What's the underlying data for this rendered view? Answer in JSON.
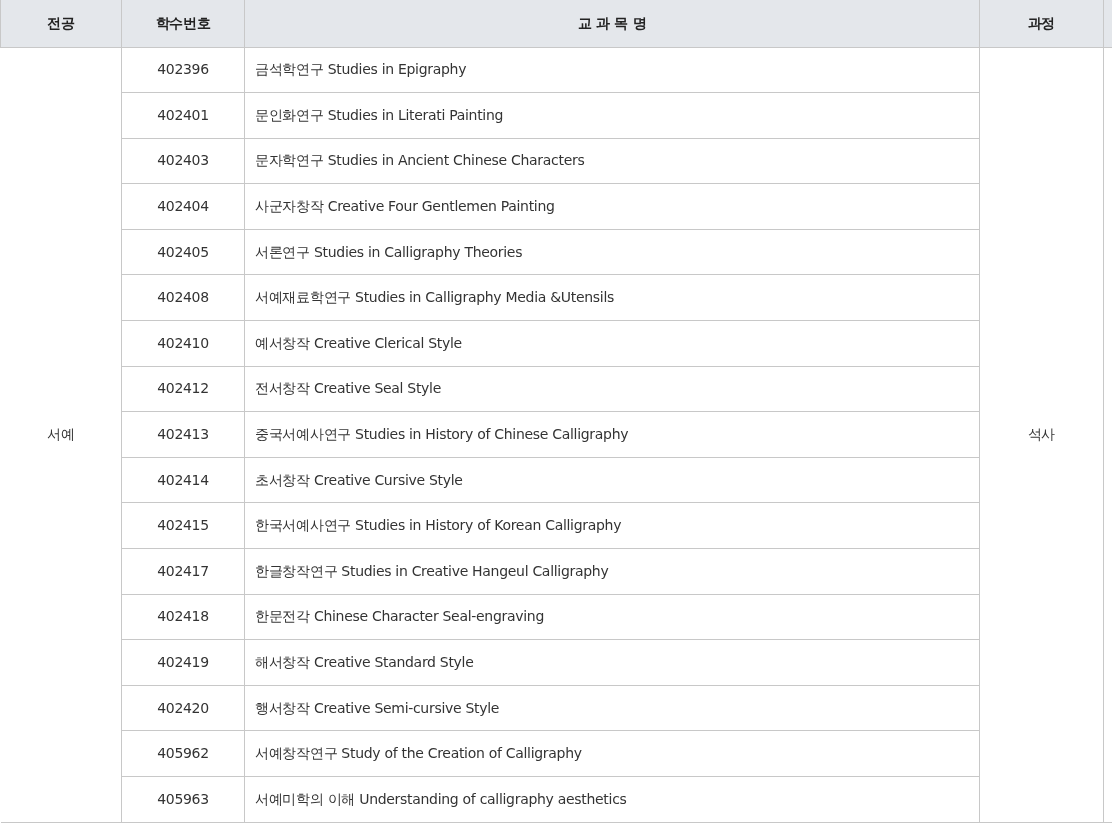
{
  "table": {
    "columns": [
      "전공",
      "학수번호",
      "교 과 목 명",
      "과정"
    ],
    "major": "서예",
    "program": "석사",
    "rows": [
      {
        "code": "402396",
        "name": "금석학연구 Studies in Epigraphy"
      },
      {
        "code": "402401",
        "name": "문인화연구 Studies in Literati Painting"
      },
      {
        "code": "402403",
        "name": "문자학연구 Studies in Ancient Chinese Characters"
      },
      {
        "code": "402404",
        "name": "사군자창작 Creative Four Gentlemen Painting"
      },
      {
        "code": "402405",
        "name": "서론연구 Studies in Calligraphy Theories"
      },
      {
        "code": "402408",
        "name": "서예재료학연구 Studies in Calligraphy Media &Utensils"
      },
      {
        "code": "402410",
        "name": "예서창작 Creative Clerical Style"
      },
      {
        "code": "402412",
        "name": "전서창작 Creative Seal Style"
      },
      {
        "code": "402413",
        "name": "중국서예사연구 Studies in History of Chinese Calligraphy"
      },
      {
        "code": "402414",
        "name": "초서창작 Creative Cursive Style"
      },
      {
        "code": "402415",
        "name": "한국서예사연구 Studies in History of Korean Calligraphy"
      },
      {
        "code": "402417",
        "name": "한글창작연구 Studies in Creative Hangeul Calligraphy"
      },
      {
        "code": "402418",
        "name": "한문전각 Chinese Character Seal-engraving"
      },
      {
        "code": "402419",
        "name": "해서창작 Creative Standard Style"
      },
      {
        "code": "402420",
        "name": "행서창작 Creative Semi-cursive Style"
      },
      {
        "code": "405962",
        "name": "서예창작연구 Study of the Creation of Calligraphy"
      },
      {
        "code": "405963",
        "name": "서예미학의 이해 Understanding of calligraphy aesthetics"
      }
    ]
  }
}
